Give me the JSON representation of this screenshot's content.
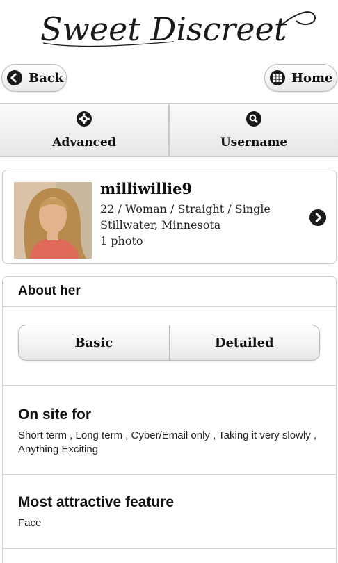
{
  "header": {
    "logo_text": "Sweet Discreet"
  },
  "nav": {
    "back_label": "Back",
    "home_label": "Home"
  },
  "tabs": [
    {
      "label": "Advanced",
      "icon": "gear-icon"
    },
    {
      "label": "Username",
      "icon": "search-icon"
    }
  ],
  "profile": {
    "username": "milliwillie9",
    "details": "22 / Woman / Straight / Single",
    "location": "Stillwater, Minnesota",
    "photos": "1 photo"
  },
  "about": {
    "title": "About her",
    "segments": [
      "Basic",
      "Detailed"
    ],
    "sections": [
      {
        "heading": "On site for",
        "text": "Short term , Long term , Cyber/Email only , Taking it very slowly , Anything Exciting"
      },
      {
        "heading": "Most attractive feature",
        "text": "Face"
      }
    ]
  },
  "colors": {
    "icon_dark": "#1a1a1a",
    "border": "#cfcfcf",
    "accent_bg": "#e9e9e9"
  }
}
